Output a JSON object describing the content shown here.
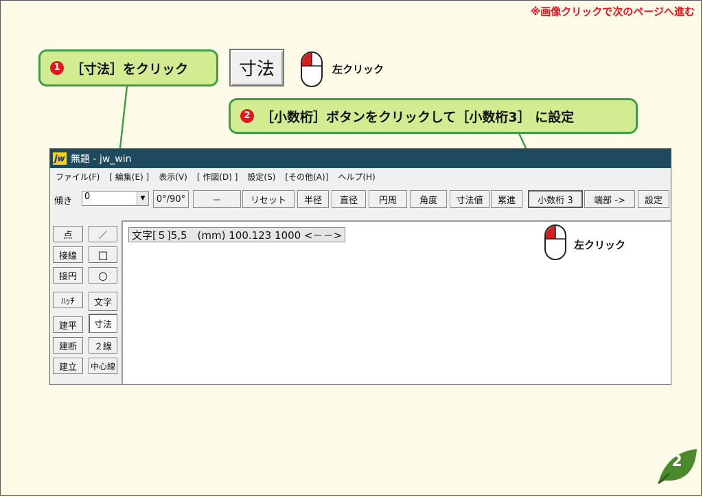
{
  "note": "※画像クリックで次のページへ進む",
  "callout1": {
    "num": "1",
    "text": "［寸法］をクリック"
  },
  "callout2": {
    "num": "2",
    "text": "［小数桁］ボタンをクリックして［小数桁3］ に設定"
  },
  "big_button_label": "寸法",
  "left_click_label": "左クリック",
  "window": {
    "logo": "jw",
    "title": "無題 - jw_win",
    "menu": [
      "ファイル(F)",
      "[ 編集(E) ]",
      "表示(V)",
      "[ 作図(D) ]",
      "設定(S)",
      "[その他(A)]",
      "ヘルプ(H)"
    ],
    "toolbar": {
      "tilt_label": "傾き",
      "tilt_value": "0",
      "buttons": [
        "0°/90°",
        "－",
        "リセット",
        "半径",
        "直径",
        "円周",
        "角度",
        "寸法値",
        "累進",
        "小数桁 3",
        "端部 ->",
        "設定"
      ]
    },
    "left_buttons": [
      "点",
      "接線",
      "接円",
      "ﾊｯﾁ",
      "建平",
      "建断",
      "建立"
    ],
    "right_buttons": [
      "／",
      "□",
      "○",
      "文字",
      "寸法",
      "２線",
      "中心線"
    ],
    "text_sample": "文字[５]5,5　(mm) 100.123  1000  <－－>"
  },
  "page_number": "2",
  "colors": {
    "accent_red": "#e8141e",
    "callout_bg": "#d3ec91",
    "callout_border": "#3e9e43",
    "titlebar": "#1d4a5e",
    "page_bg": "#fefbe8"
  }
}
